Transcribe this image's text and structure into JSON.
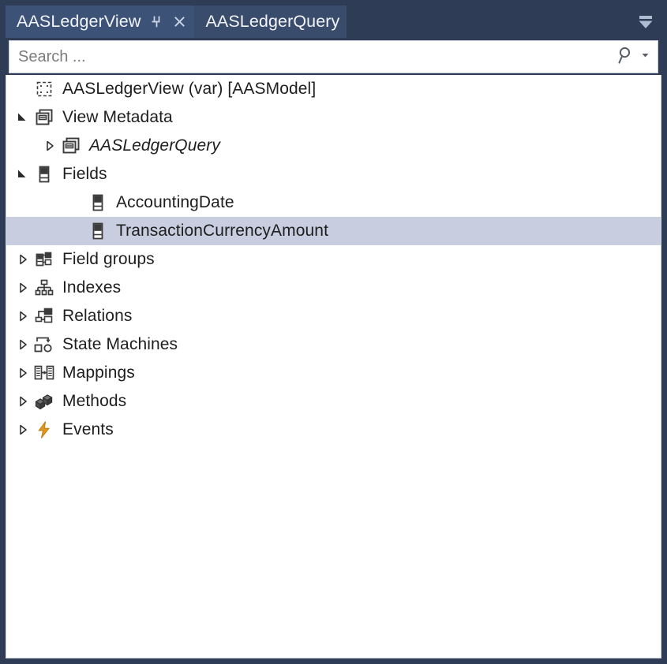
{
  "window": {
    "frame_color": "#2e3d55",
    "content_bg": "#ffffff"
  },
  "tabs": {
    "items": [
      {
        "label": "AASLedgerView",
        "active": true,
        "pin_icon": "pin-icon",
        "close_icon": "close-icon"
      },
      {
        "label": "AASLedgerQuery",
        "active": false
      }
    ],
    "dropdown_icon": "window-list-dropdown-icon"
  },
  "search": {
    "placeholder": "Search ...",
    "value": "",
    "search_icon": "search-icon",
    "dropdown_icon": "chevron-down-icon"
  },
  "tree": {
    "selected_color": "#c8cddf",
    "nodes": [
      {
        "label": "AASLedgerView (var) [AASModel]",
        "icon": "dashed-square-icon",
        "indent": 1,
        "twisty": "none",
        "italic": false,
        "selected": false
      },
      {
        "label": "View Metadata",
        "icon": "view-window-icon",
        "indent": 1,
        "twisty": "expanded",
        "italic": false,
        "selected": false
      },
      {
        "label": "AASLedgerQuery",
        "icon": "view-window-icon",
        "indent": 2,
        "twisty": "collapsed",
        "italic": true,
        "selected": false
      },
      {
        "label": "Fields",
        "icon": "field-icon",
        "indent": 1,
        "twisty": "expanded",
        "italic": false,
        "selected": false
      },
      {
        "label": "AccountingDate",
        "icon": "field-icon",
        "indent": 3,
        "twisty": "none",
        "italic": false,
        "selected": false
      },
      {
        "label": "TransactionCurrencyAmount",
        "icon": "field-icon",
        "indent": 3,
        "twisty": "none",
        "italic": false,
        "selected": true
      },
      {
        "label": "Field groups",
        "icon": "field-groups-icon",
        "indent": 1,
        "twisty": "collapsed",
        "italic": false,
        "selected": false
      },
      {
        "label": "Indexes",
        "icon": "indexes-icon",
        "indent": 1,
        "twisty": "collapsed",
        "italic": false,
        "selected": false
      },
      {
        "label": "Relations",
        "icon": "relations-icon",
        "indent": 1,
        "twisty": "collapsed",
        "italic": false,
        "selected": false
      },
      {
        "label": "State Machines",
        "icon": "state-machines-icon",
        "indent": 1,
        "twisty": "collapsed",
        "italic": false,
        "selected": false
      },
      {
        "label": "Mappings",
        "icon": "mappings-icon",
        "indent": 1,
        "twisty": "collapsed",
        "italic": false,
        "selected": false
      },
      {
        "label": "Methods",
        "icon": "methods-icon",
        "indent": 1,
        "twisty": "collapsed",
        "italic": false,
        "selected": false
      },
      {
        "label": "Events",
        "icon": "events-icon",
        "indent": 1,
        "twisty": "collapsed",
        "italic": false,
        "selected": false
      }
    ]
  }
}
